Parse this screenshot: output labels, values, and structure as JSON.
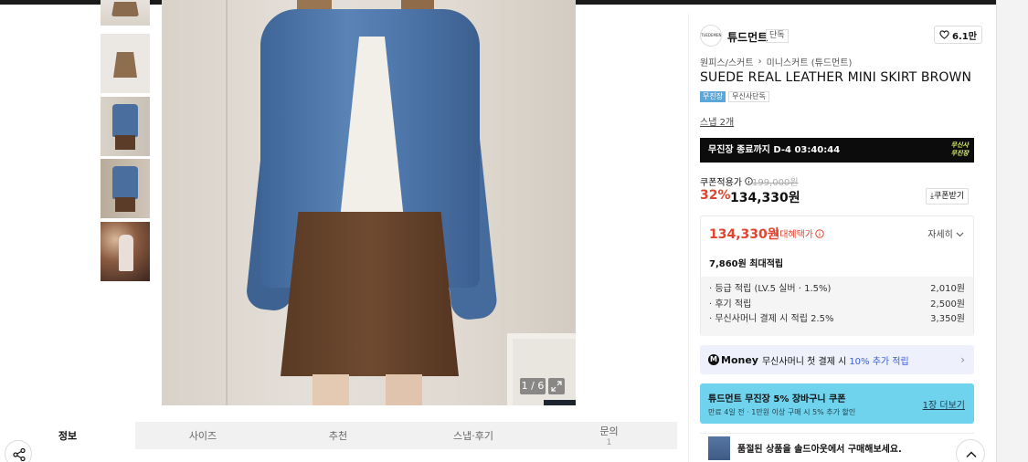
{
  "brand": {
    "logo_text": "TUEDEMENT",
    "name": "튜드먼트",
    "tag": "단독",
    "likes": "6.1만"
  },
  "breadcrumb": {
    "category": "원피스/스커트",
    "separator": "›",
    "subcategory": "미니스커트 (튜드먼트)"
  },
  "product": {
    "title": "SUEDE REAL LEATHER MINI SKIRT BROWN",
    "badge_primary": "무진장",
    "badge_secondary": "무신사단독",
    "snap_link": "스냅 2개"
  },
  "timer": {
    "text": "무진장 종료까지 D-4 03:40:44",
    "logo_line1": "무신사",
    "logo_line2": "무진장"
  },
  "price": {
    "coupon_label": "쿠폰적용가",
    "original": "199,000원",
    "discount": "32%",
    "final": "134,330원",
    "coupon_button": "쿠폰받기"
  },
  "benefit": {
    "price": "134,330원",
    "label": "최대혜택가",
    "detail_link": "자세히",
    "points_total": "7,860원 최대적립",
    "rows": [
      {
        "label": "· 등급 적립 (LV.5 실버 · 1.5%)",
        "value": "2,010원"
      },
      {
        "label": "· 후기 적립",
        "value": "2,500원"
      },
      {
        "label": "· 무신사머니 결제 시 적립 2.5%",
        "value": "3,350원"
      }
    ]
  },
  "money": {
    "logo_m": "M",
    "logo_text": "Money",
    "text": "무신사머니 첫 결제 시",
    "highlight": "10% 추가 적립",
    "chevron": "›"
  },
  "coupon": {
    "title": "튜드먼트 무진장 5% 장바구니 쿠폰",
    "subtitle": "만료 4일 전 · 1만원 이상 구매 시 5% 추가 할인",
    "link": "1장 더보기"
  },
  "soldout": {
    "text": "품절된 상품을 솔드아웃에서 구매해보세요."
  },
  "gallery": {
    "counter": "1 / 6"
  },
  "tabs": [
    {
      "label": "정보",
      "count": ""
    },
    {
      "label": "사이즈",
      "count": ""
    },
    {
      "label": "추천",
      "count": ""
    },
    {
      "label": "스냅·후기",
      "count": ""
    },
    {
      "label": "문의",
      "count": "1"
    }
  ],
  "colors": {
    "accent_red": "#e0442f",
    "timer_bg": "#0c0c0c",
    "coupon_bg": "#70d3ee",
    "money_bg": "#eef1fc",
    "badge_blue": "#5ba7d9"
  },
  "icons": [
    "heart-icon",
    "info-icon",
    "download-icon",
    "chevron-down-icon",
    "chevron-right-icon",
    "expand-icon",
    "share-icon",
    "chevron-up-icon"
  ]
}
